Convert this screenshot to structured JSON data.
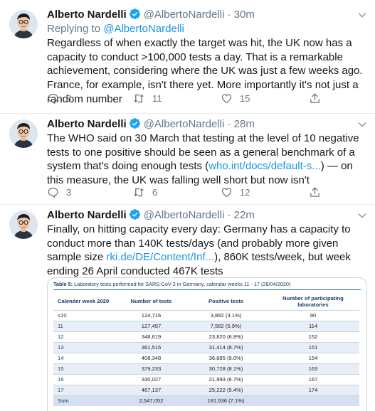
{
  "colors": {
    "accent": "#1b95e0",
    "verified": "#1da1f2",
    "muted": "#657786",
    "text": "#14171a"
  },
  "tweets": [
    {
      "author": "Alberto Nardelli",
      "handle": "@AlbertoNardelli",
      "separator": "·",
      "time": "30m",
      "replying_label": "Replying to",
      "replying_to": "@AlbertoNardelli",
      "text": "Regardless of when exactly the target was hit, the UK now has a capacity to conduct >100,000 tests a day. That is a remarkable achievement, considering where the UK was just a few weeks ago. France, for example, isn't there yet. More importantly it's not just a random number",
      "reply_count": "8",
      "retweet_count": "11",
      "like_count": "15"
    },
    {
      "author": "Alberto Nardelli",
      "handle": "@AlbertoNardelli",
      "separator": "·",
      "time": "28m",
      "text_before_link": "The WHO said on 30 March that testing at the level of 10 negative tests to one positive should be seen as a general benchmark of a system that's doing enough tests (",
      "link": "who.int/docs/default-s...",
      "text_after_link": ") — on this measure, the UK was falling well short but now isn't",
      "reply_count": "3",
      "retweet_count": "6",
      "like_count": "12"
    },
    {
      "author": "Alberto Nardelli",
      "handle": "@AlbertoNardelli",
      "separator": "·",
      "time": "22m",
      "text_before_link": "Finally, on hitting capacity every day: Germany has a capacity to conduct more than 140K tests/days (and probably more given sample size ",
      "link": "rki.de/DE/Content/Inf...",
      "text_after_link": "), 860K tests/week, but week ending 26 April conducted 467K tests"
    }
  ],
  "table_image": {
    "caption_label": "Table 5:",
    "caption_text": " Laboratory tests performed for SARS-CoV-2 in Germany, calendar weeks 11 - 17 (28/04/2020)",
    "headers": [
      "Calender week 2020",
      "Number of tests",
      "Positive tests",
      "Number of participating laboratories"
    ],
    "rows": [
      [
        "≤10",
        "124,716",
        "3,892 (3.1%)",
        "90"
      ],
      [
        "11",
        "127,457",
        "7,582 (5.9%)",
        "114"
      ],
      [
        "12",
        "348,619",
        "23,820 (6.8%)",
        "152"
      ],
      [
        "13",
        "361,515",
        "31,414 (8.7%)",
        "151"
      ],
      [
        "14",
        "408,348",
        "36,885 (9.0%)",
        "154"
      ],
      [
        "15",
        "379,233",
        "30,728 (8.1%)",
        "163"
      ],
      [
        "16",
        "330,027",
        "21,993 (6.7%)",
        "167"
      ],
      [
        "17",
        "467,137",
        "25,222 (5.4%)",
        "174"
      ],
      [
        "Sum",
        "2,547,052",
        "181,536 (7.1%)",
        ""
      ]
    ]
  }
}
